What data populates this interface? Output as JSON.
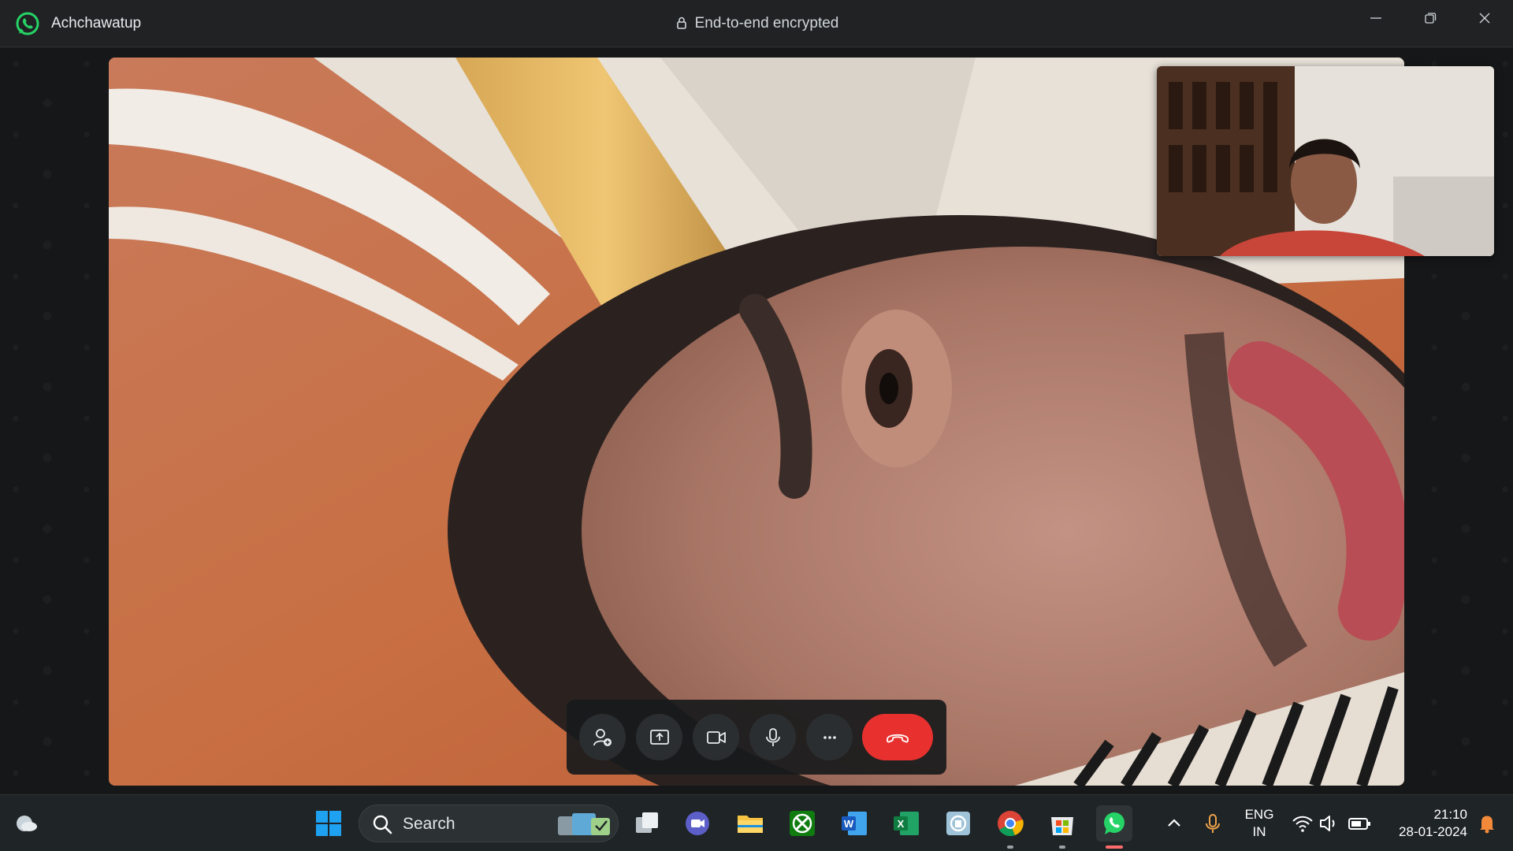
{
  "window": {
    "app_name": "Achchawatup",
    "encryption_label": "End-to-end encrypted",
    "controls": [
      "minimize-icon",
      "restore-icon",
      "close-icon"
    ]
  },
  "call": {
    "controls": [
      "add-person-icon",
      "share-screen-icon",
      "video-camera-icon",
      "microphone-icon",
      "more-icon",
      "end-call-icon"
    ],
    "end_call_color": "#e8312f"
  },
  "taskbar": {
    "search_placeholder": "Search",
    "apps": [
      "windows-start-icon",
      "task-view-icon",
      "meet-icon",
      "file-explorer-icon",
      "xbox-icon",
      "word-icon",
      "excel-icon",
      "remote-icon",
      "chrome-icon",
      "store-icon",
      "whatsapp-icon"
    ],
    "tray": {
      "language": "ENG",
      "region": "IN",
      "time": "21:10",
      "date": "28-01-2024"
    }
  },
  "colors": {
    "accent_whatsapp": "#25d366",
    "titlebar_bg": "#202223",
    "taskbar_bg": "#1f2426"
  }
}
